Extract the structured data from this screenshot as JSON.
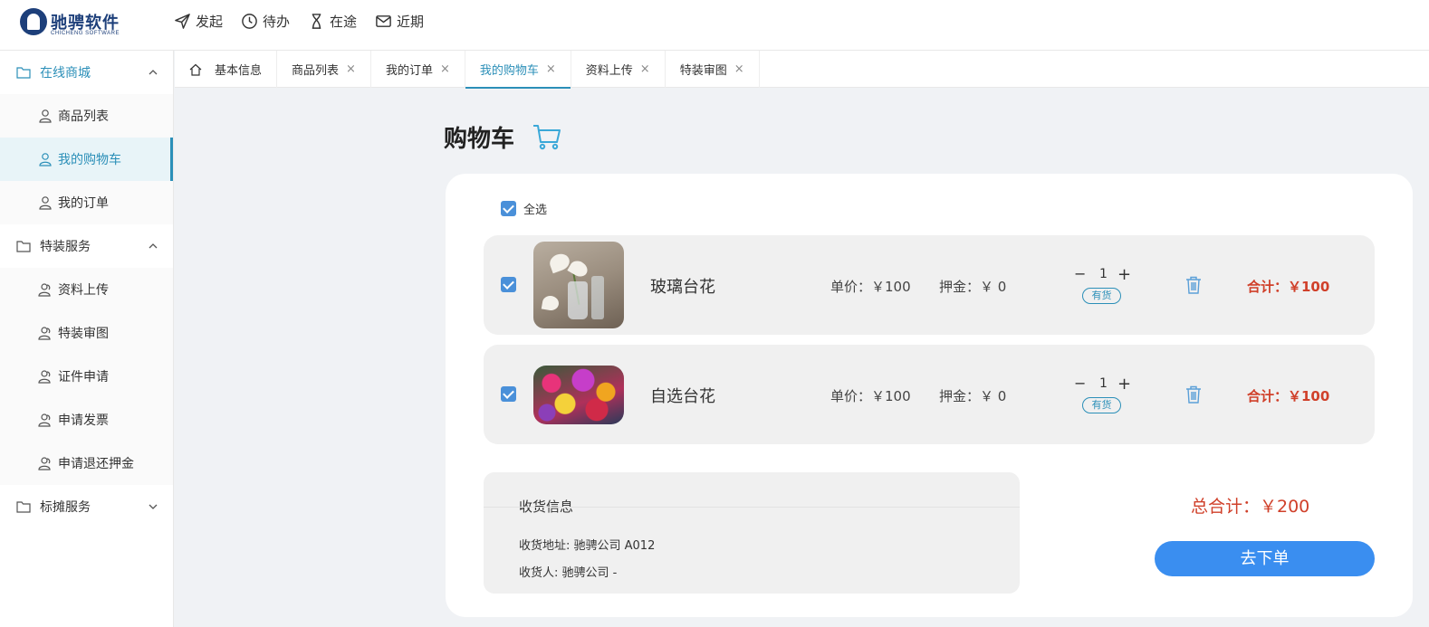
{
  "app": {
    "logo_title": "驰骋软件",
    "logo_sub": "CHICHENG SOFTWARE"
  },
  "topnav": [
    {
      "label": "发起",
      "icon": "send-icon"
    },
    {
      "label": "待办",
      "icon": "clock-icon"
    },
    {
      "label": "在途",
      "icon": "hourglass-icon"
    },
    {
      "label": "近期",
      "icon": "mail-icon"
    }
  ],
  "sidebar": {
    "groups": [
      {
        "label": "在线商城",
        "expanded": true,
        "items": [
          {
            "label": "商品列表"
          },
          {
            "label": "我的购物车",
            "active": true
          },
          {
            "label": "我的订单"
          }
        ]
      },
      {
        "label": "特装服务",
        "expanded": true,
        "items": [
          {
            "label": "资料上传"
          },
          {
            "label": "特装审图"
          },
          {
            "label": "证件申请"
          },
          {
            "label": "申请发票"
          },
          {
            "label": "申请退还押金"
          }
        ]
      },
      {
        "label": "标摊服务",
        "expanded": false,
        "items": []
      }
    ]
  },
  "tabs": [
    {
      "label": "基本信息",
      "closable": false
    },
    {
      "label": "商品列表",
      "closable": true
    },
    {
      "label": "我的订单",
      "closable": true
    },
    {
      "label": "我的购物车",
      "closable": true,
      "active": true
    },
    {
      "label": "资料上传",
      "closable": true
    },
    {
      "label": "特装审图",
      "closable": true
    }
  ],
  "close_glyph": "×",
  "cart": {
    "title": "购物车",
    "select_all_label": "全选",
    "select_all_checked": true,
    "items": [
      {
        "name": "玻璃台花",
        "price": "单价：￥100",
        "deposit": "押金：￥ 0",
        "qty": "1",
        "stock": "有货",
        "subtotal": "合计：￥100",
        "checked": true
      },
      {
        "name": "自选台花",
        "price": "单价：￥100",
        "deposit": "押金：￥ 0",
        "qty": "1",
        "stock": "有货",
        "subtotal": "合计：￥100",
        "checked": true
      }
    ],
    "shipping": {
      "title": "收货信息",
      "address": "收货地址: 驰骋公司 A012",
      "receiver": "收货人: 驰骋公司 -"
    },
    "grand_total": "总合计：￥200",
    "order_button": "去下单"
  },
  "colors": {
    "accent": "#2b8fb8",
    "price_red": "#d0402a",
    "button_blue": "#3a8ef0"
  }
}
